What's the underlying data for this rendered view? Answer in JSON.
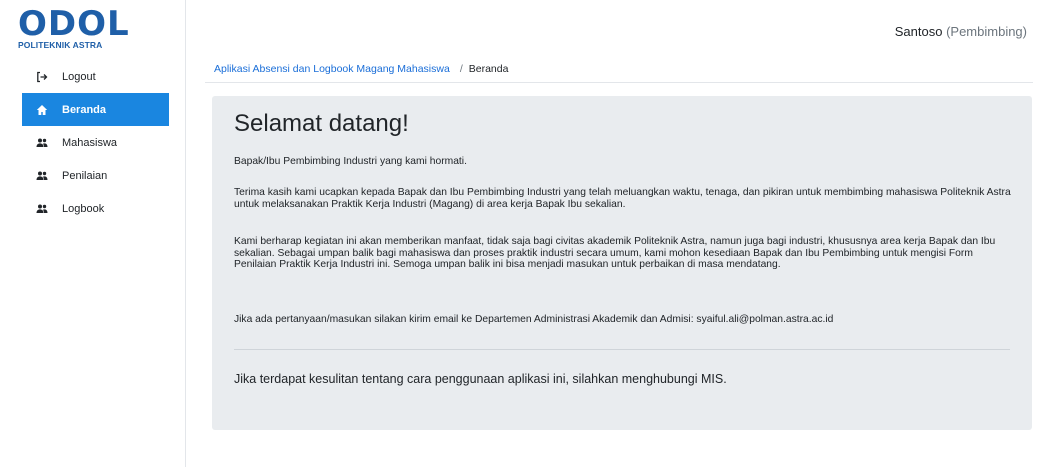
{
  "brand": {
    "logo_text": "ODOL",
    "logo_subtitle": "POLITEKNIK ASTRA"
  },
  "header": {
    "user_name": "Santoso",
    "user_role": "(Pembimbing)"
  },
  "sidebar": {
    "items": [
      {
        "label": "Logout",
        "icon": "logout-icon",
        "active": false
      },
      {
        "label": "Beranda",
        "icon": "home-icon",
        "active": true
      },
      {
        "label": "Mahasiswa",
        "icon": "users-icon",
        "active": false
      },
      {
        "label": "Penilaian",
        "icon": "users-icon",
        "active": false
      },
      {
        "label": "Logbook",
        "icon": "users-icon",
        "active": false
      }
    ]
  },
  "breadcrumb": {
    "app": "Aplikasi Absensi dan Logbook Magang Mahasiswa",
    "separator": "/",
    "current": "Beranda"
  },
  "content": {
    "title": "Selamat datang!",
    "greeting": "Bapak/Ibu Pembimbing Industri yang kami hormati.",
    "paragraph1": "Terima kasih kami ucapkan kepada Bapak dan Ibu Pembimbing Industri yang telah meluangkan waktu, tenaga, dan pikiran untuk membimbing mahasiswa Politeknik Astra untuk melaksanakan Praktik Kerja Industri (Magang) di area kerja Bapak Ibu sekalian.",
    "paragraph2": "Kami berharap kegiatan ini akan memberikan manfaat, tidak saja bagi civitas akademik Politeknik Astra, namun juga bagi industri, khususnya area kerja Bapak dan Ibu sekalian. Sebagai umpan balik bagi mahasiswa dan proses praktik industri secara umum, kami mohon kesediaan Bapak dan Ibu Pembimbing untuk mengisi Form Penilaian Praktik Kerja Industri ini. Semoga umpan balik ini bisa menjadi masukan untuk perbaikan di masa mendatang.",
    "contact": "Jika ada pertanyaan/masukan silakan kirim email ke Departemen Administrasi Akademik dan Admisi: syaiful.ali@polman.astra.ac.id",
    "help": "Jika terdapat kesulitan tentang cara penggunaan aplikasi ini, silahkan menghubungi MIS."
  },
  "colors": {
    "brand": "#1f5fa8",
    "active_nav": "#1a86e0",
    "card_bg": "#e9ecef",
    "link": "#1a6ed8"
  }
}
